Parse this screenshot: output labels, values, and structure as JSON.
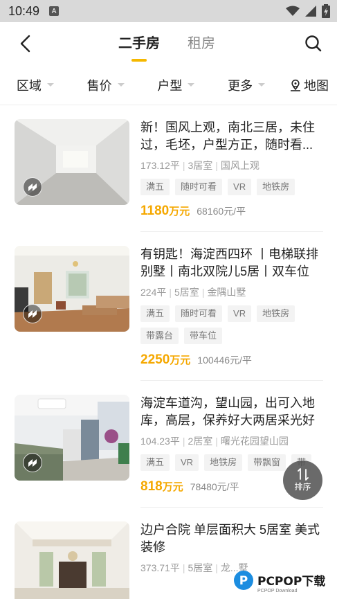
{
  "status_bar": {
    "time": "10:49",
    "notification_glyph": "A"
  },
  "header": {
    "tabs": [
      {
        "label": "二手房",
        "active": true
      },
      {
        "label": "租房",
        "active": false
      }
    ]
  },
  "filters": [
    {
      "label": "区域"
    },
    {
      "label": "售价"
    },
    {
      "label": "户型"
    },
    {
      "label": "更多"
    },
    {
      "label": "地图"
    }
  ],
  "listings": [
    {
      "title": "新！国风上观，南北三居，未住过，毛坯，户型方正，随时看...",
      "area": "173.12平",
      "rooms": "3居室",
      "community": "国风上观",
      "tags": [
        "满五",
        "随时可看",
        "VR",
        "地铁房"
      ],
      "price_value": "1180",
      "price_unit": "万元",
      "unit_price": "68160元/平"
    },
    {
      "title": "有钥匙！海淀西四环 丨电梯联排别墅丨南北双院儿5居丨双车位",
      "area": "224平",
      "rooms": "5居室",
      "community": "金隅山墅",
      "tags": [
        "满五",
        "随时可看",
        "VR",
        "地铁房",
        "带露台",
        "带车位"
      ],
      "price_value": "2250",
      "price_unit": "万元",
      "unit_price": "100446元/平"
    },
    {
      "title": "海淀车道沟，望山园，出可入地库，高层，保养好大两居采光好",
      "area": "104.23平",
      "rooms": "2居室",
      "community": "曙光花园望山园",
      "tags": [
        "满五",
        "VR",
        "地铁房",
        "带飘窗",
        "带"
      ],
      "price_value": "818",
      "price_unit": "万元",
      "unit_price": "78480元/平"
    },
    {
      "title": "边户合院 单层面积大 5居室 美式装修",
      "area": "373.71平",
      "rooms": "5居室",
      "community": "龙...墅",
      "tags": [],
      "price_value": "",
      "price_unit": "",
      "unit_price": ""
    }
  ],
  "sort_button": {
    "label": "排序"
  },
  "watermark": {
    "text": "PCPOP下载",
    "sub": "PCPOP Download"
  },
  "colors": {
    "accent": "#f5b800",
    "price": "#f5a800",
    "status_bar": "#d9d9d9"
  }
}
